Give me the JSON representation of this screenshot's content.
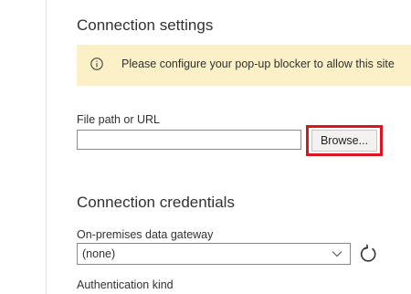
{
  "connection_settings": {
    "title": "Connection settings",
    "info_banner": {
      "icon": "info-icon",
      "message": "Please configure your pop-up blocker to allow this site"
    },
    "file_path": {
      "label": "File path or URL",
      "value": "",
      "placeholder": ""
    },
    "browse_button_label": "Browse..."
  },
  "connection_credentials": {
    "title": "Connection credentials",
    "gateway": {
      "label": "On-premises data gateway",
      "selected": "(none)",
      "chevron_icon": "chevron-down-icon",
      "refresh_icon": "refresh-icon"
    },
    "authentication_kind": {
      "label": "Authentication kind"
    }
  },
  "colors": {
    "banner_background": "#fcf0c7",
    "highlight_border": "#e0141e",
    "button_background": "#f3f2f1"
  }
}
